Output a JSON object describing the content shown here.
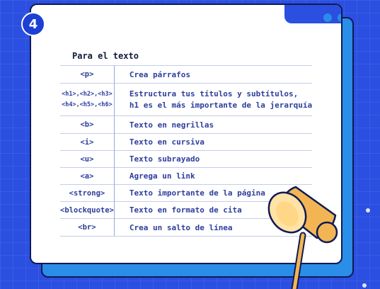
{
  "badge_number": "4",
  "heading": "Para el texto",
  "rows": [
    {
      "tag": "<p>",
      "desc": [
        "Crea párrafos"
      ]
    },
    {
      "tag": [
        "<h1>,<h2>,<h3>",
        "<h4>,<h5>,<h6>"
      ],
      "desc": [
        "Estructura tus títulos y subtítulos,",
        "h1 es el más importante de la jerarquía"
      ]
    },
    {
      "tag": "<b>",
      "desc": [
        "Texto en negrillas"
      ]
    },
    {
      "tag": "<i>",
      "desc": [
        "Texto en cursiva"
      ]
    },
    {
      "tag": "<u>",
      "desc": [
        "Texto subrayado"
      ]
    },
    {
      "tag": "<a>",
      "desc": [
        "Agrega un link"
      ]
    },
    {
      "tag": "<strong>",
      "desc": [
        "Texto importante de la página"
      ]
    },
    {
      "tag": "<blockquote>",
      "desc": [
        "Texto en formato de cita"
      ]
    },
    {
      "tag": "<br>",
      "desc": [
        "Crea un salto de línea"
      ]
    }
  ],
  "colors": {
    "background": "#2b4fe0",
    "card": "#ffffff",
    "card_shadow": "#2a8de8",
    "outline": "#0f1a55",
    "text": "#2c3e9c",
    "lamp": "#f3b553"
  },
  "icons": [
    "window-dots-icon",
    "lamp-icon",
    "sparkle-icon"
  ]
}
